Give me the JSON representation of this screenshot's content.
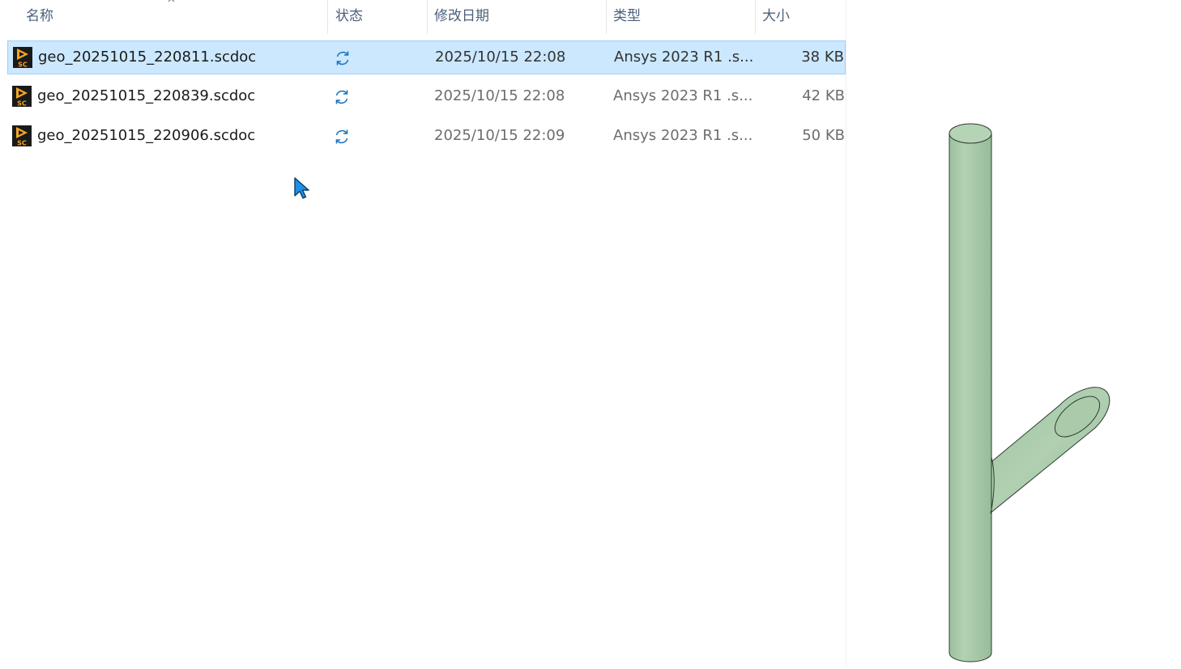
{
  "columns": {
    "name": "名称",
    "status": "状态",
    "modified": "修改日期",
    "type": "类型",
    "size": "大小"
  },
  "sort_indicator": "^",
  "files": [
    {
      "name": "geo_20251015_220811.scdoc",
      "status_icon": "sync-icon",
      "modified": "2025/10/15 22:08",
      "type": "Ansys 2023 R1 .s...",
      "size": "38 KB",
      "selected": true
    },
    {
      "name": "geo_20251015_220839.scdoc",
      "status_icon": "sync-icon",
      "modified": "2025/10/15 22:08",
      "type": "Ansys 2023 R1 .s...",
      "size": "42 KB",
      "selected": false
    },
    {
      "name": "geo_20251015_220906.scdoc",
      "status_icon": "sync-icon",
      "modified": "2025/10/15 22:09",
      "type": "Ansys 2023 R1 .s...",
      "size": "50 KB",
      "selected": false
    }
  ],
  "file_icon": {
    "name": "spaceclaim-file-icon",
    "label": "SC"
  },
  "colors": {
    "selection_bg": "#cce8ff",
    "selection_border": "#99d1ff",
    "sync_blue": "#1e73be",
    "geometry_green": "#a6c8a8"
  }
}
